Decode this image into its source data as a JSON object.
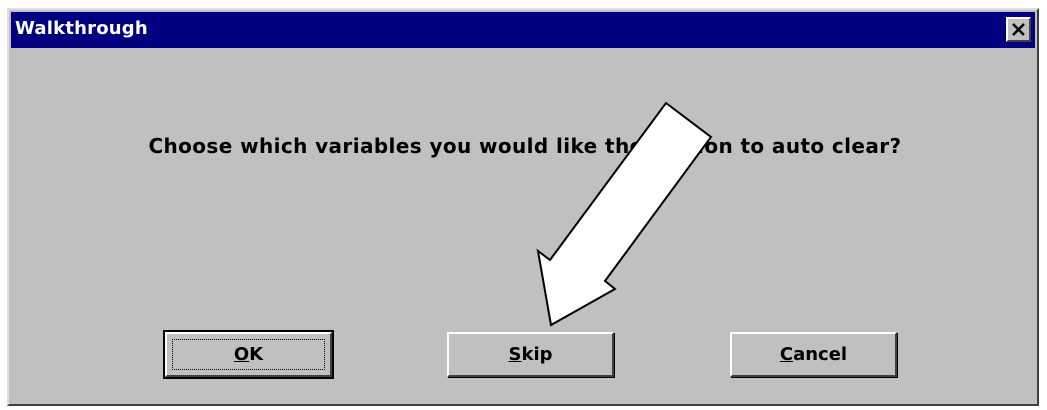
{
  "window": {
    "title": "Walkthrough"
  },
  "message": "Choose which variables you would like the station to auto clear?",
  "buttons": {
    "ok": {
      "mnemonic": "O",
      "rest": "K"
    },
    "skip": {
      "mnemonic": "S",
      "rest": "kip"
    },
    "cancel": {
      "mnemonic": "C",
      "rest": "ancel"
    }
  },
  "icons": {
    "close": "close-icon",
    "pointer": "arrow-icon"
  },
  "colors": {
    "titlebar": "#000080",
    "face": "#c0c0c0",
    "text": "#000000"
  }
}
